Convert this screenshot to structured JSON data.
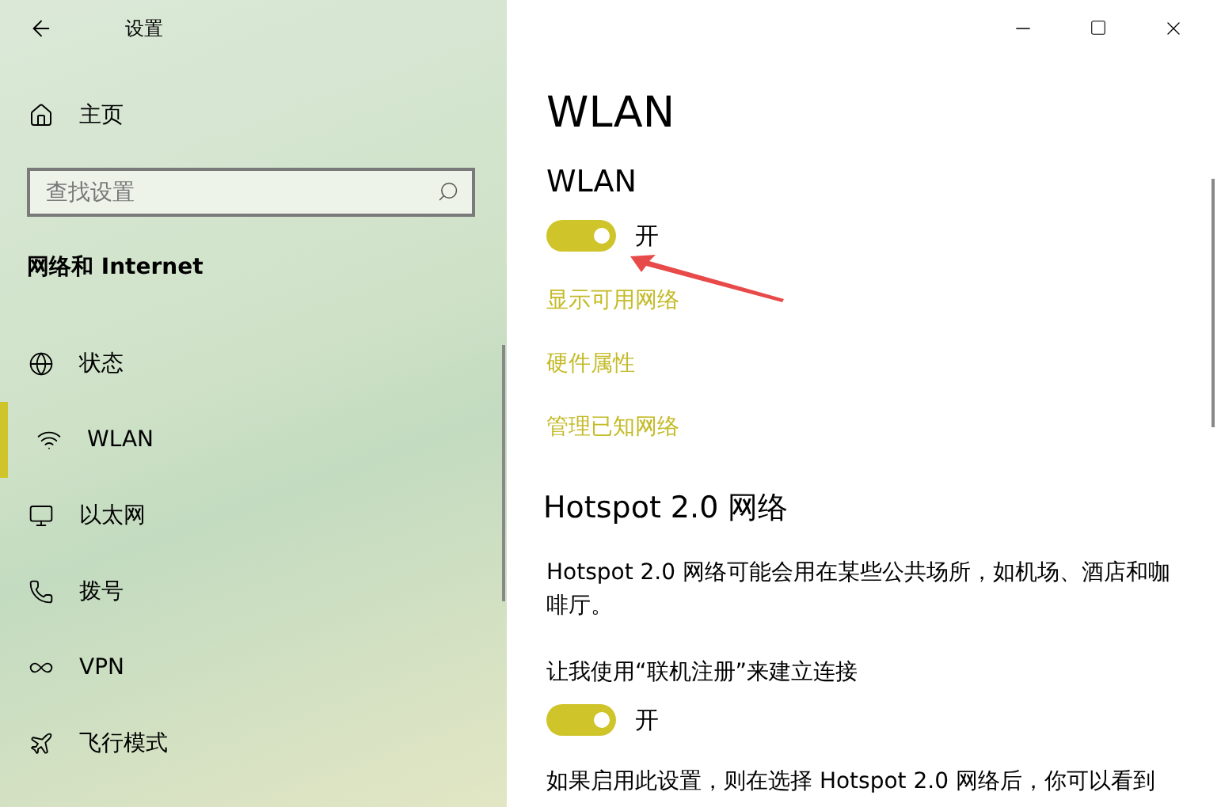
{
  "window": {
    "title": "设置"
  },
  "sidebar": {
    "home": "主页",
    "search": {
      "placeholder": "查找设置"
    },
    "section": "网络和 Internet",
    "items": [
      {
        "label": "状态",
        "kind": "status",
        "selected": false
      },
      {
        "label": "WLAN",
        "kind": "wifi",
        "selected": true
      },
      {
        "label": "以太网",
        "kind": "ethernet",
        "selected": false
      },
      {
        "label": "拨号",
        "kind": "dialup",
        "selected": false
      },
      {
        "label": "VPN",
        "kind": "vpn",
        "selected": false
      },
      {
        "label": "飞行模式",
        "kind": "airplane",
        "selected": false
      }
    ]
  },
  "content": {
    "title": "WLAN",
    "wlan": {
      "heading": "WLAN",
      "toggle": {
        "on": true,
        "label": "开"
      }
    },
    "links": [
      "显示可用网络",
      "硬件属性",
      "管理已知网络"
    ],
    "hotspot": {
      "heading": "Hotspot 2.0 网络",
      "description": "Hotspot 2.0 网络可能会用在某些公共场所，如机场、酒店和咖啡厅。",
      "option": "让我使用“联机注册”来建立连接",
      "toggle": {
        "on": true,
        "label": "开"
      },
      "note": "如果启用此设置，则在选择 Hotspot 2.0 网络后，你可以看到"
    }
  }
}
